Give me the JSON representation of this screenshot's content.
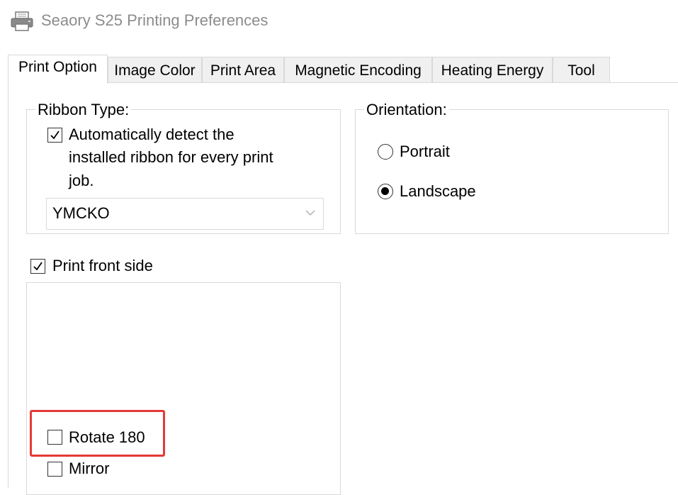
{
  "window": {
    "title": "Seaory S25 Printing Preferences",
    "icon": "printer-icon"
  },
  "tabs": [
    {
      "label": "Print Option",
      "active": true
    },
    {
      "label": "Image Color",
      "active": false
    },
    {
      "label": "Print Area",
      "active": false
    },
    {
      "label": "Magnetic Encoding",
      "active": false
    },
    {
      "label": "Heating Energy",
      "active": false
    },
    {
      "label": "Tool",
      "active": false
    }
  ],
  "ribbon": {
    "legend": "Ribbon Type:",
    "auto_detect_label_line1": "Automatically detect the",
    "auto_detect_label_line2": "installed ribbon for every print",
    "auto_detect_label_line3": "job.",
    "auto_detect_checked": true,
    "selected_ribbon": "YMCKO"
  },
  "orientation": {
    "legend": "Orientation:",
    "options": [
      {
        "label": "Portrait",
        "selected": false
      },
      {
        "label": "Landscape",
        "selected": true
      }
    ]
  },
  "front_side": {
    "print_front_label": "Print front side",
    "print_front_checked": true,
    "rotate_label": "Rotate 180",
    "rotate_checked": false,
    "mirror_label": "Mirror",
    "mirror_checked": false
  },
  "annotation": {
    "highlight_color": "#e53935"
  }
}
